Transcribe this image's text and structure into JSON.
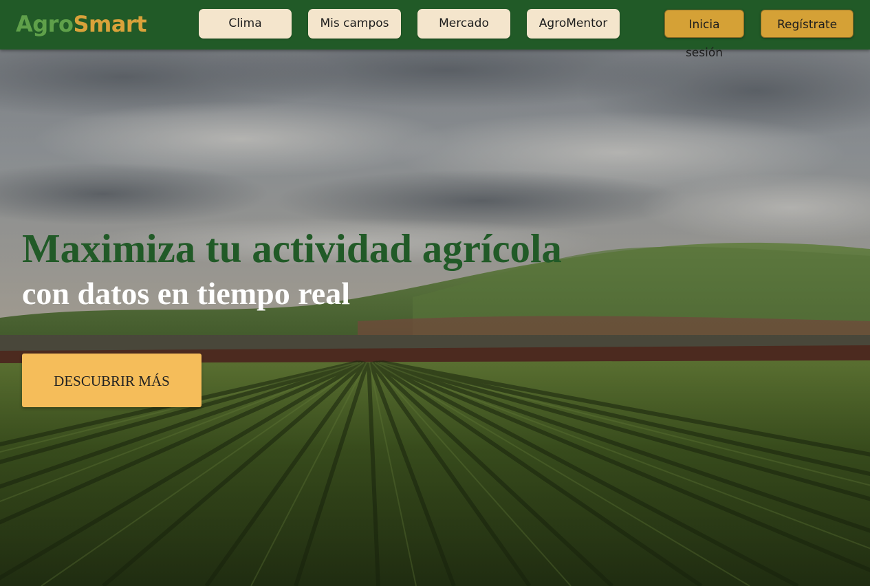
{
  "header": {
    "logo": {
      "part1": "Agro",
      "part2": "Smart"
    },
    "nav": [
      {
        "label": "Clima"
      },
      {
        "label": "Mis campos"
      },
      {
        "label": "Mercado"
      },
      {
        "label": "AgroMentor"
      }
    ],
    "auth": {
      "login_label": "Inicia sesión",
      "signup_label": "Regístrate"
    }
  },
  "hero": {
    "headline": "Maximiza tu actividad agrícola",
    "subheadline": "con datos en tiempo real",
    "cta_label": "DESCUBRIR MÁS",
    "background_image": "farm-field-photo"
  },
  "colors": {
    "nav_background": "#215a27",
    "nav_button": "#f4e5cc",
    "auth_button": "#d5a136",
    "headline": "#215a27",
    "cta": "#f5bd5a"
  }
}
